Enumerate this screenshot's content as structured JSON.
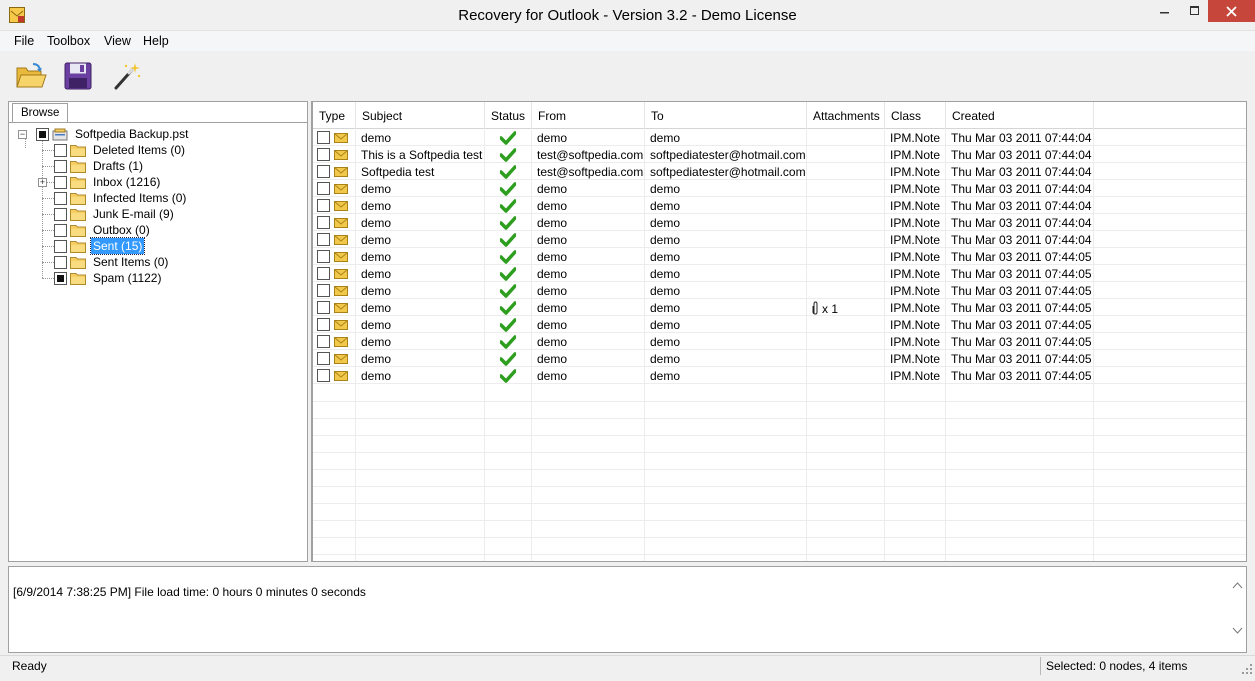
{
  "window": {
    "title": "Recovery for Outlook - Version 3.2 - Demo License"
  },
  "menu": [
    "File",
    "Toolbox",
    "View",
    "Help"
  ],
  "toolbar": {
    "buttons": [
      "open-folder-icon",
      "save-icon",
      "wizard-wand-icon"
    ]
  },
  "browse_tab": "Browse",
  "tree": {
    "root": "Softpedia Backup.pst",
    "folders": [
      {
        "label": "Deleted Items (0)",
        "checked": false,
        "expandable": false,
        "selected": false
      },
      {
        "label": "Drafts (1)",
        "checked": false,
        "expandable": false,
        "selected": false
      },
      {
        "label": "Inbox (1216)",
        "checked": false,
        "expandable": true,
        "selected": false
      },
      {
        "label": "Infected Items (0)",
        "checked": false,
        "expandable": false,
        "selected": false
      },
      {
        "label": "Junk E-mail (9)",
        "checked": false,
        "expandable": false,
        "selected": false
      },
      {
        "label": "Outbox (0)",
        "checked": false,
        "expandable": false,
        "selected": false
      },
      {
        "label": "Sent (15)",
        "checked": false,
        "expandable": false,
        "selected": true
      },
      {
        "label": "Sent Items (0)",
        "checked": false,
        "expandable": false,
        "selected": false
      },
      {
        "label": "Spam (1122)",
        "checked": true,
        "expandable": false,
        "selected": false
      }
    ]
  },
  "grid": {
    "columns": [
      "Type",
      "Subject",
      "Status",
      "From",
      "To",
      "Attachments",
      "Class",
      "Created"
    ],
    "rows": [
      {
        "subject": "demo",
        "from": "demo",
        "to": "demo",
        "attachments": "",
        "class": "IPM.Note",
        "created": "Thu Mar 03 2011 07:44:04"
      },
      {
        "subject": "This is a Softpedia test",
        "from": "test@softpedia.com",
        "to": "softpediatester@hotmail.com",
        "attachments": "",
        "class": "IPM.Note",
        "created": "Thu Mar 03 2011 07:44:04"
      },
      {
        "subject": "Softpedia test",
        "from": "test@softpedia.com",
        "to": "softpediatester@hotmail.com",
        "attachments": "",
        "class": "IPM.Note",
        "created": "Thu Mar 03 2011 07:44:04"
      },
      {
        "subject": "demo",
        "from": "demo",
        "to": "demo",
        "attachments": "",
        "class": "IPM.Note",
        "created": "Thu Mar 03 2011 07:44:04"
      },
      {
        "subject": "demo",
        "from": "demo",
        "to": "demo",
        "attachments": "",
        "class": "IPM.Note",
        "created": "Thu Mar 03 2011 07:44:04"
      },
      {
        "subject": "demo",
        "from": "demo",
        "to": "demo",
        "attachments": "",
        "class": "IPM.Note",
        "created": "Thu Mar 03 2011 07:44:04"
      },
      {
        "subject": "demo",
        "from": "demo",
        "to": "demo",
        "attachments": "",
        "class": "IPM.Note",
        "created": "Thu Mar 03 2011 07:44:04"
      },
      {
        "subject": "demo",
        "from": "demo",
        "to": "demo",
        "attachments": "",
        "class": "IPM.Note",
        "created": "Thu Mar 03 2011 07:44:05"
      },
      {
        "subject": "demo",
        "from": "demo",
        "to": "demo",
        "attachments": "",
        "class": "IPM.Note",
        "created": "Thu Mar 03 2011 07:44:05"
      },
      {
        "subject": "demo",
        "from": "demo",
        "to": "demo",
        "attachments": "",
        "class": "IPM.Note",
        "created": "Thu Mar 03 2011 07:44:05"
      },
      {
        "subject": "demo",
        "from": "demo",
        "to": "demo",
        "attachments": "x 1",
        "class": "IPM.Note",
        "created": "Thu Mar 03 2011 07:44:05"
      },
      {
        "subject": "demo",
        "from": "demo",
        "to": "demo",
        "attachments": "",
        "class": "IPM.Note",
        "created": "Thu Mar 03 2011 07:44:05"
      },
      {
        "subject": "demo",
        "from": "demo",
        "to": "demo",
        "attachments": "",
        "class": "IPM.Note",
        "created": "Thu Mar 03 2011 07:44:05"
      },
      {
        "subject": "demo",
        "from": "demo",
        "to": "demo",
        "attachments": "",
        "class": "IPM.Note",
        "created": "Thu Mar 03 2011 07:44:05"
      },
      {
        "subject": "demo",
        "from": "demo",
        "to": "demo",
        "attachments": "",
        "class": "IPM.Note",
        "created": "Thu Mar 03 2011 07:44:05"
      }
    ]
  },
  "log": {
    "text": "[6/9/2014 7:38:25 PM] File load time: 0 hours 0 minutes 0 seconds"
  },
  "statusbar": {
    "left": "Ready",
    "right": "Selected: 0 nodes, 4 items"
  },
  "colors": {
    "close_button": "#c7463b",
    "selection": "#3399ff",
    "status_check": "#2e9e1f",
    "envelope": "#f2c84b",
    "folder": "#f5cf63"
  }
}
